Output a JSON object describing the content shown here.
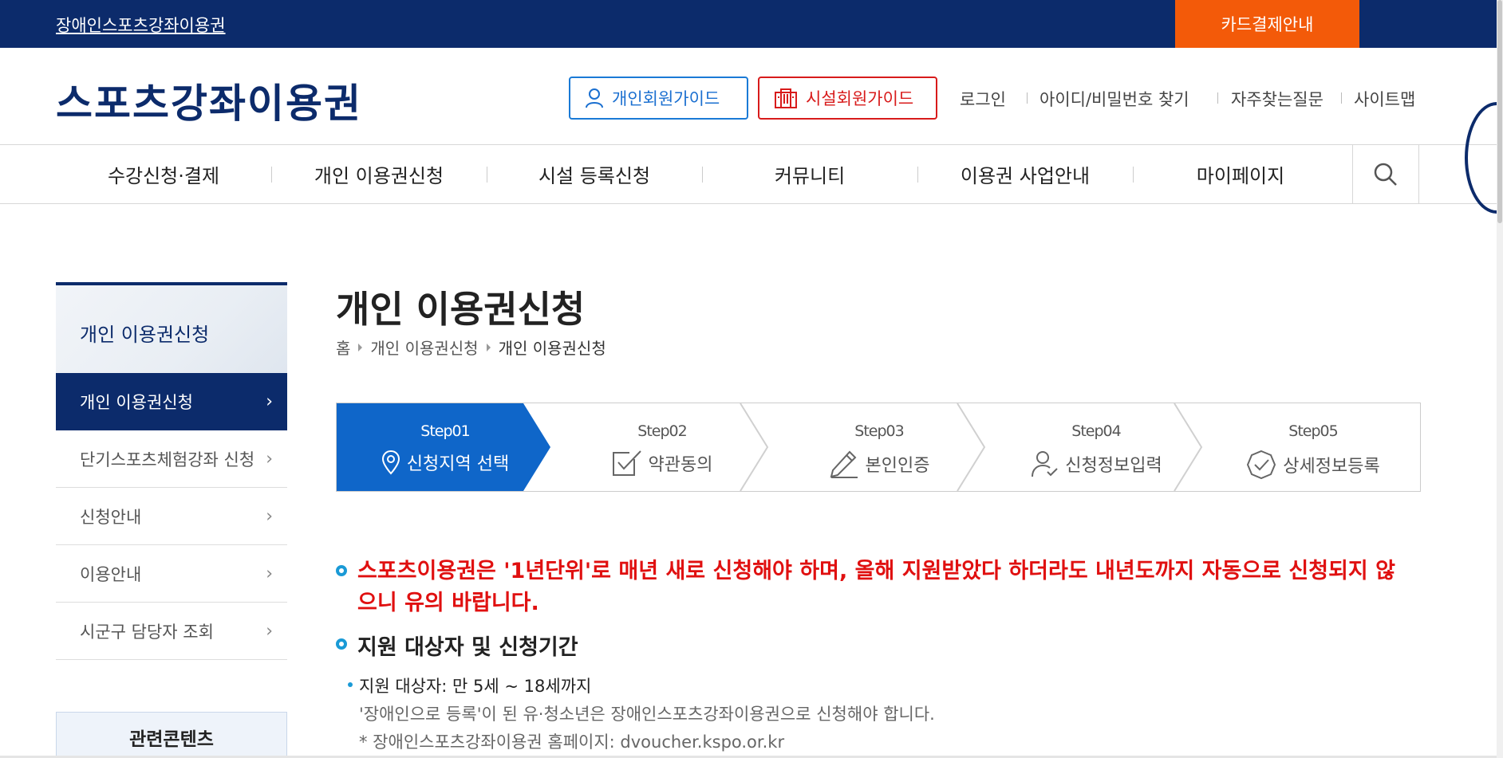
{
  "topbar": {
    "link": "장애인스포츠강좌이용권",
    "card_button": "카드결제안내",
    "bg_color": "#0c2b6b",
    "card_color": "#f35a09"
  },
  "header": {
    "logo": "스포츠강좌이용권",
    "guide_personal": "개인회원가이드",
    "guide_facility": "시설회원가이드",
    "util": [
      "로그인",
      "아이디/비밀번호 찾기",
      "자주찾는질문",
      "사이트맵"
    ]
  },
  "gnb": {
    "items": [
      "수강신청·결제",
      "개인 이용권신청",
      "시설 등록신청",
      "커뮤니티",
      "이용권 사업안내",
      "마이페이지"
    ],
    "search_icon": "search-icon"
  },
  "sidebar": {
    "title": "개인 이용권신청",
    "items": [
      {
        "label": "개인 이용권신청",
        "active": true
      },
      {
        "label": "단기스포츠체험강좌 신청",
        "active": false
      },
      {
        "label": "신청안내",
        "active": false
      },
      {
        "label": "이용안내",
        "active": false
      },
      {
        "label": "시군구 담당자 조회",
        "active": false
      }
    ],
    "related": "관련콘텐츠"
  },
  "main": {
    "title": "개인 이용권신청",
    "breadcrumb": [
      "홈",
      "개인 이용권신청",
      "개인 이용권신청"
    ],
    "steps": [
      {
        "num": "Step01",
        "label": "신청지역 선택",
        "icon": "location-pin-icon",
        "active": true
      },
      {
        "num": "Step02",
        "label": "약관동의",
        "icon": "checkbox-icon",
        "active": false
      },
      {
        "num": "Step03",
        "label": "본인인증",
        "icon": "pencil-icon",
        "active": false
      },
      {
        "num": "Step04",
        "label": "신청정보입력",
        "icon": "user-check-icon",
        "active": false
      },
      {
        "num": "Step05",
        "label": "상세정보등록",
        "icon": "badge-check-icon",
        "active": false
      }
    ],
    "notice_red_line1": "스포츠이용권은 '1년단위'로 매년 새로 신청해야 하며, 올해 지원받았다 하더라도 내년도까지 자동으로 신청되지 않",
    "notice_red_line2": "으니 유의 바랍니다.",
    "section_title": "지원 대상자 및 신청기간",
    "target_label": "지원 대상자: 만 5세 ~ 18세까지",
    "target_note": "'장애인으로 등록'이 된 유·청소년은 장애인스포츠강좌이용권으로 신청해야 합니다.",
    "target_url_note": "* 장애인스포츠강좌이용권 홈페이지: dvoucher.kspo.or.kr"
  }
}
